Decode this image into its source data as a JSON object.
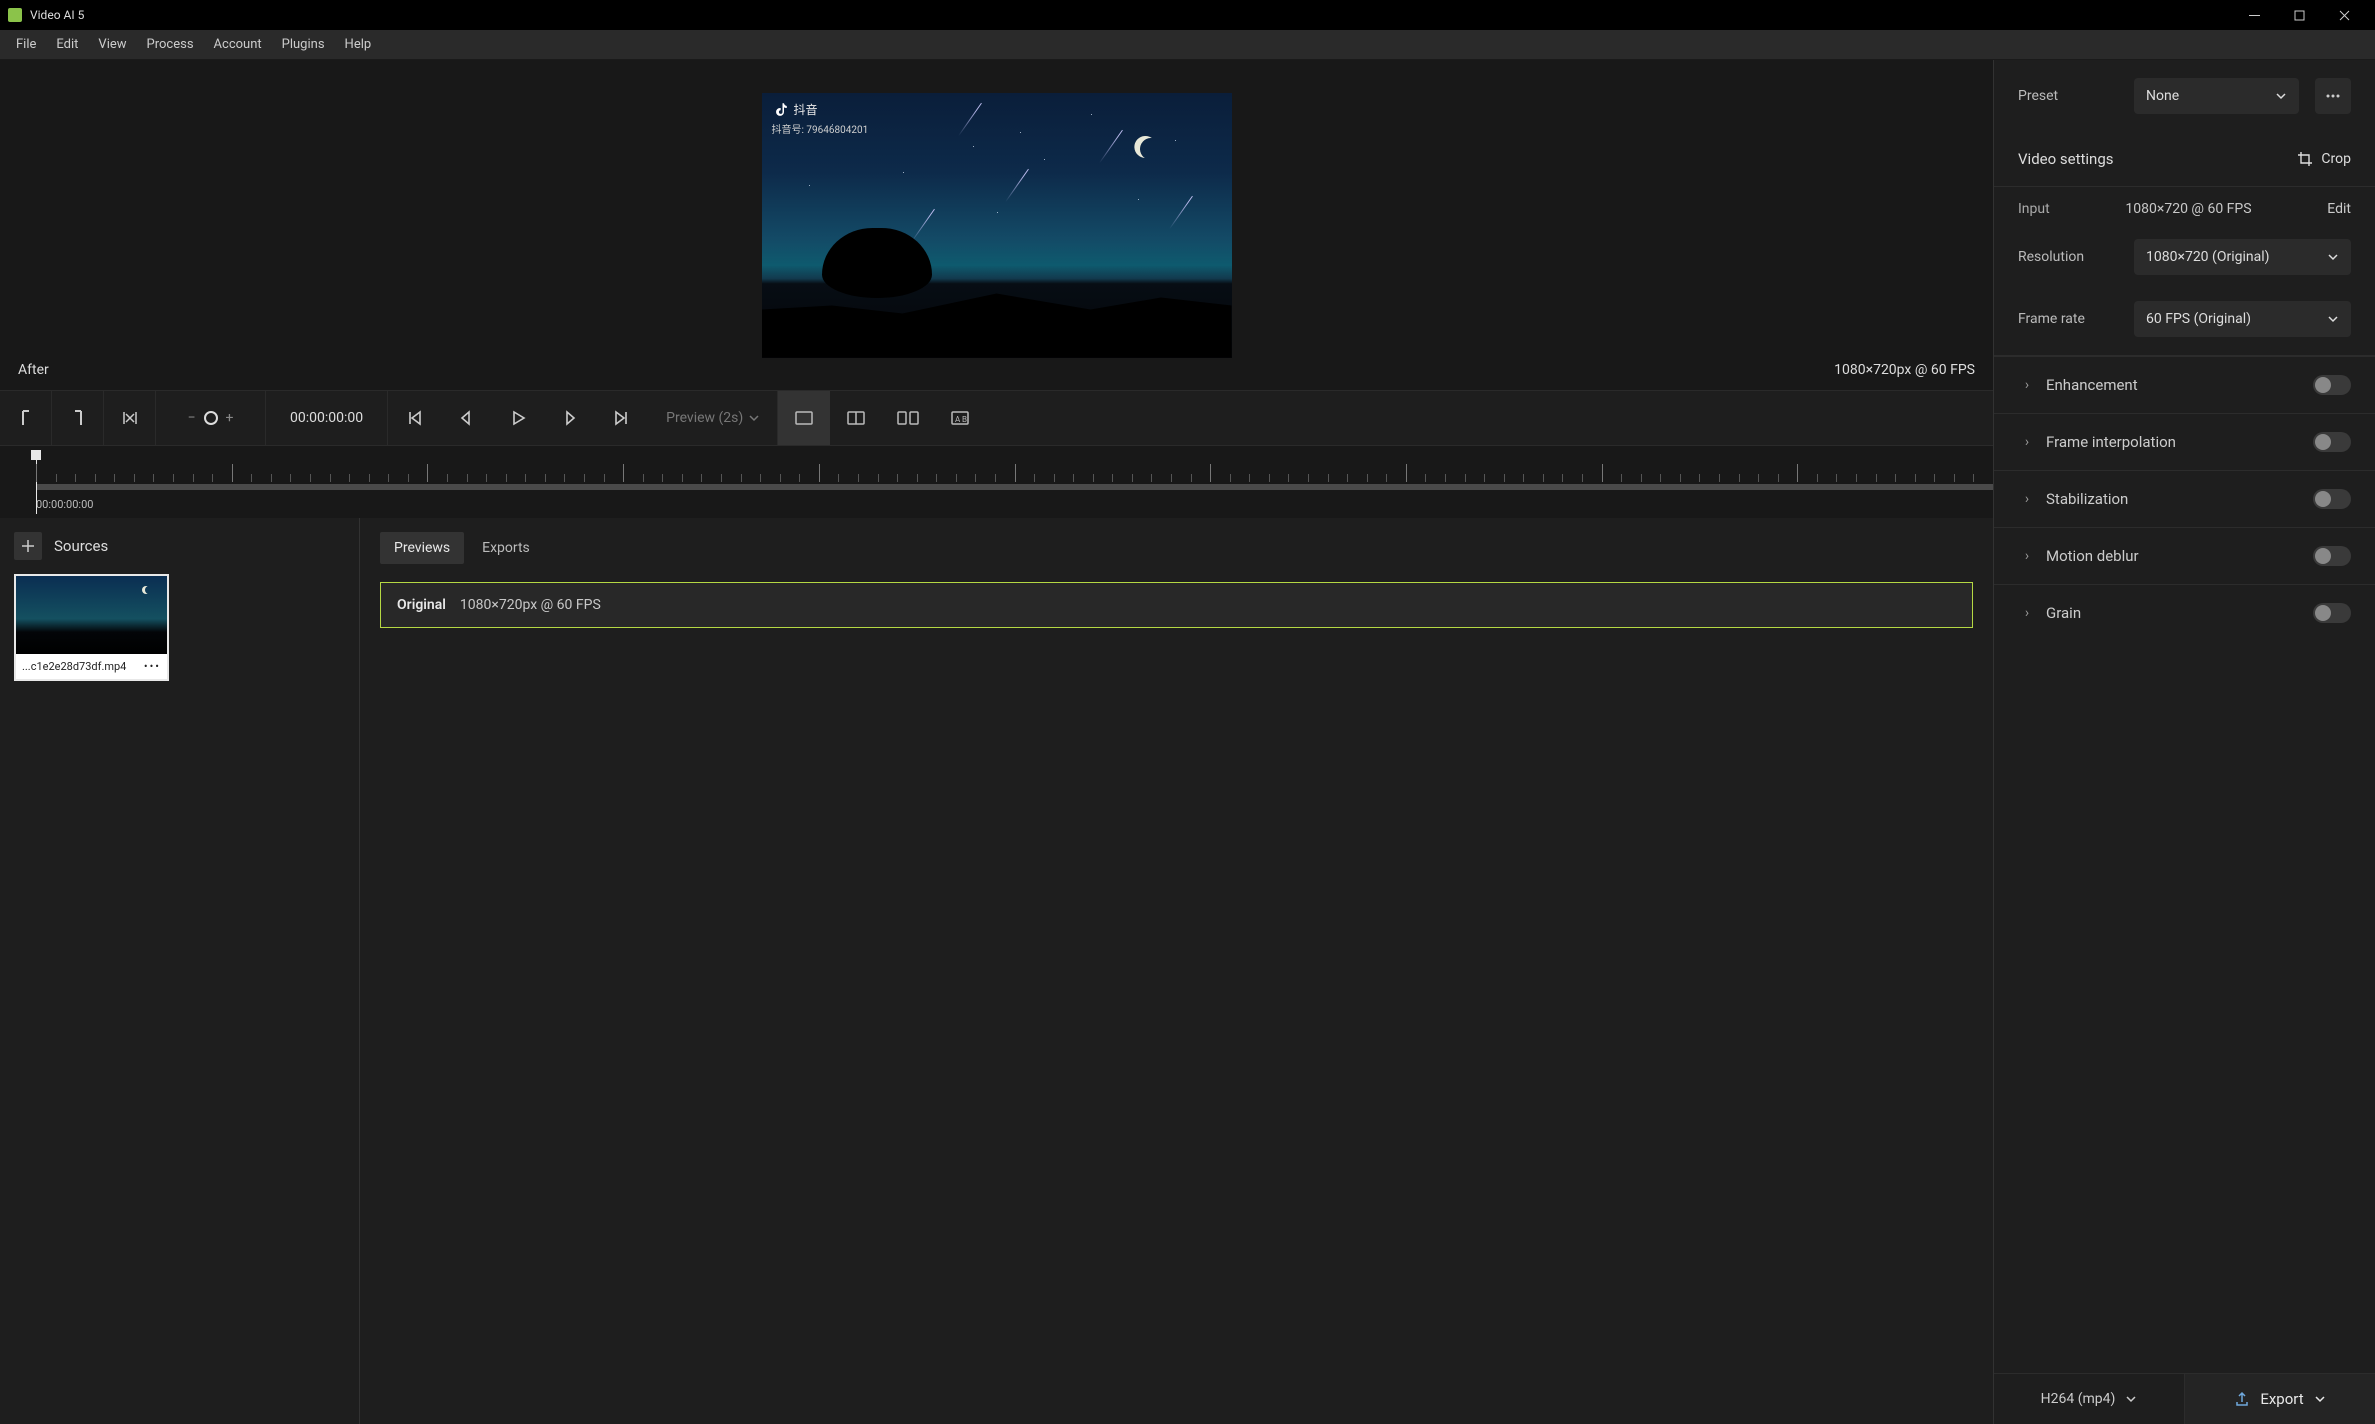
{
  "titlebar": {
    "title": "Video AI 5"
  },
  "menubar": [
    "File",
    "Edit",
    "View",
    "Process",
    "Account",
    "Plugins",
    "Help"
  ],
  "preview": {
    "watermark_brand": "抖音",
    "watermark_id": "抖音号: 79646804201",
    "after_label": "After",
    "resolution_label": "1080×720px @ 60 FPS"
  },
  "transport": {
    "timecode": "00:00:00:00",
    "preview_label": "Preview (2s)"
  },
  "timeline": {
    "start_tc": "00:00:00:00"
  },
  "sources": {
    "header": "Sources",
    "file_name": "...c1e2e28d73df.mp4",
    "more": "•••"
  },
  "previews": {
    "tabs": {
      "previews": "Previews",
      "exports": "Exports"
    },
    "chip": {
      "title": "Original",
      "detail": "1080×720px @ 60 FPS"
    }
  },
  "right": {
    "preset": {
      "label": "Preset",
      "value": "None"
    },
    "video_settings": "Video settings",
    "crop": "Crop",
    "input": {
      "label": "Input",
      "value": "1080×720 @ 60 FPS",
      "edit": "Edit"
    },
    "resolution": {
      "label": "Resolution",
      "value": "1080×720 (Original)"
    },
    "frame_rate": {
      "label": "Frame rate",
      "value": "60 FPS (Original)"
    },
    "accordions": {
      "enhancement": "Enhancement",
      "frame_interpolation": "Frame interpolation",
      "stabilization": "Stabilization",
      "motion_deblur": "Motion deblur",
      "grain": "Grain"
    },
    "export": {
      "format": "H264 (mp4)",
      "button": "Export"
    }
  }
}
